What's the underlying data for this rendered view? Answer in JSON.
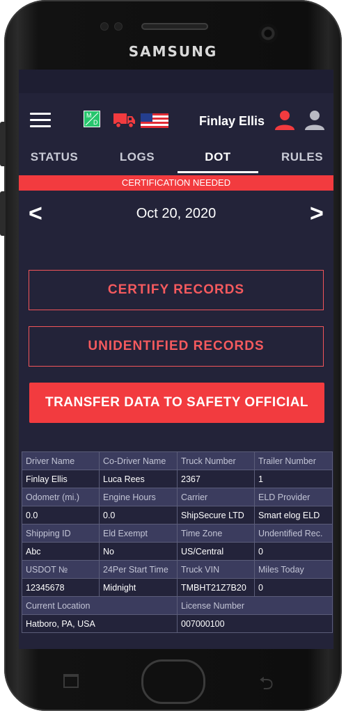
{
  "device": {
    "brand": "SAMSUNG"
  },
  "header": {
    "user_name": "Finlay Ellis",
    "md_badge": {
      "top": "M",
      "bottom": "D"
    }
  },
  "tabs": [
    {
      "label": "STATUS",
      "active": false
    },
    {
      "label": "LOGS",
      "active": false
    },
    {
      "label": "DOT",
      "active": true
    },
    {
      "label": "RULES",
      "active": false
    }
  ],
  "banner": {
    "text": "CERTIFICATION NEEDED"
  },
  "date_nav": {
    "date": "Oct 20, 2020",
    "prev_glyph": "<",
    "next_glyph": ">"
  },
  "actions": {
    "certify": "CERTIFY RECORDS",
    "unidentified": "UNIDENTIFIED RECORDS",
    "transfer": "TRANSFER DATA TO SAFETY OFFICIAL"
  },
  "info_table": [
    {
      "labels": [
        "Driver Name",
        "Co-Driver Name",
        "Truck Number",
        "Trailer Number"
      ],
      "values": [
        "Finlay Ellis",
        "Luca Rees",
        "2367",
        "1"
      ]
    },
    {
      "labels": [
        "Odometr (mi.)",
        "Engine Hours",
        "Carrier",
        "ELD Provider"
      ],
      "values": [
        "0.0",
        "0.0",
        "ShipSecure LTD",
        "Smart elog ELD"
      ]
    },
    {
      "labels": [
        "Shipping ID",
        "Eld Exempt",
        "Time Zone",
        "Undentified Rec."
      ],
      "values": [
        "Abc",
        "No",
        "US/Central",
        "0"
      ]
    },
    {
      "labels": [
        "USDOT №",
        "24Per Start Time",
        "Truck VIN",
        "Miles Today"
      ],
      "values": [
        "12345678",
        "Midnight",
        "TMBHT21Z7B20",
        "0"
      ]
    },
    {
      "labels": [
        "Current Location",
        "License Number"
      ],
      "values": [
        "Hatboro, PA, USA",
        "007000100"
      ]
    }
  ],
  "colors": {
    "screen_bg": "#232339",
    "accent_red": "#f23b3f",
    "table_label_bg": "#3b3c5e",
    "md_green": "#27c56d"
  },
  "icons": [
    "menu-icon",
    "md-badge-icon",
    "truck-icon",
    "us-flag-icon",
    "user-active-icon",
    "user-inactive-icon",
    "chevron-left-icon",
    "chevron-right-icon"
  ]
}
